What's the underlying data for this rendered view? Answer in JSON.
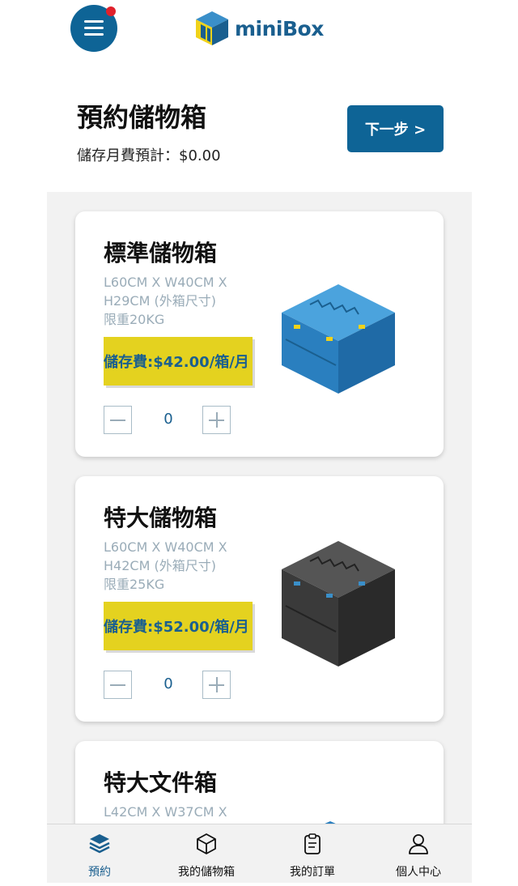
{
  "header": {
    "logo_text": "miniBox",
    "menu_icon": "hamburger-menu-icon",
    "notification_dot_color": "#e0212b"
  },
  "page": {
    "title": "預約儲物箱",
    "fee_label": "儲存月費預計：$0.00",
    "next_button": "下一步 >"
  },
  "products": [
    {
      "title": "標準儲物箱",
      "spec": "L60CM X W40CM X H29CM (外箱尺寸)",
      "weight": "限重20KG",
      "price": "儲存費:$42.00/箱/月",
      "quantity": "0",
      "box_color": "blue"
    },
    {
      "title": "特大儲物箱",
      "spec": "L60CM X W40CM X H42CM (外箱尺寸)",
      "weight": "限重25KG",
      "price": "儲存費:$52.00/箱/月",
      "quantity": "0",
      "box_color": "black"
    },
    {
      "title": "特大文件箱",
      "spec": "L42CM X W37CM X"
    }
  ],
  "bottom_nav": [
    {
      "label": "預約",
      "icon": "layers-icon",
      "active": true
    },
    {
      "label": "我的儲物箱",
      "icon": "box-icon",
      "active": false
    },
    {
      "label": "我的訂單",
      "icon": "clipboard-icon",
      "active": false
    },
    {
      "label": "個人中心",
      "icon": "user-icon",
      "active": false
    }
  ],
  "colors": {
    "primary": "#0e6496",
    "price_highlight": "#e4d21f",
    "text_muted": "#9aacb8"
  }
}
